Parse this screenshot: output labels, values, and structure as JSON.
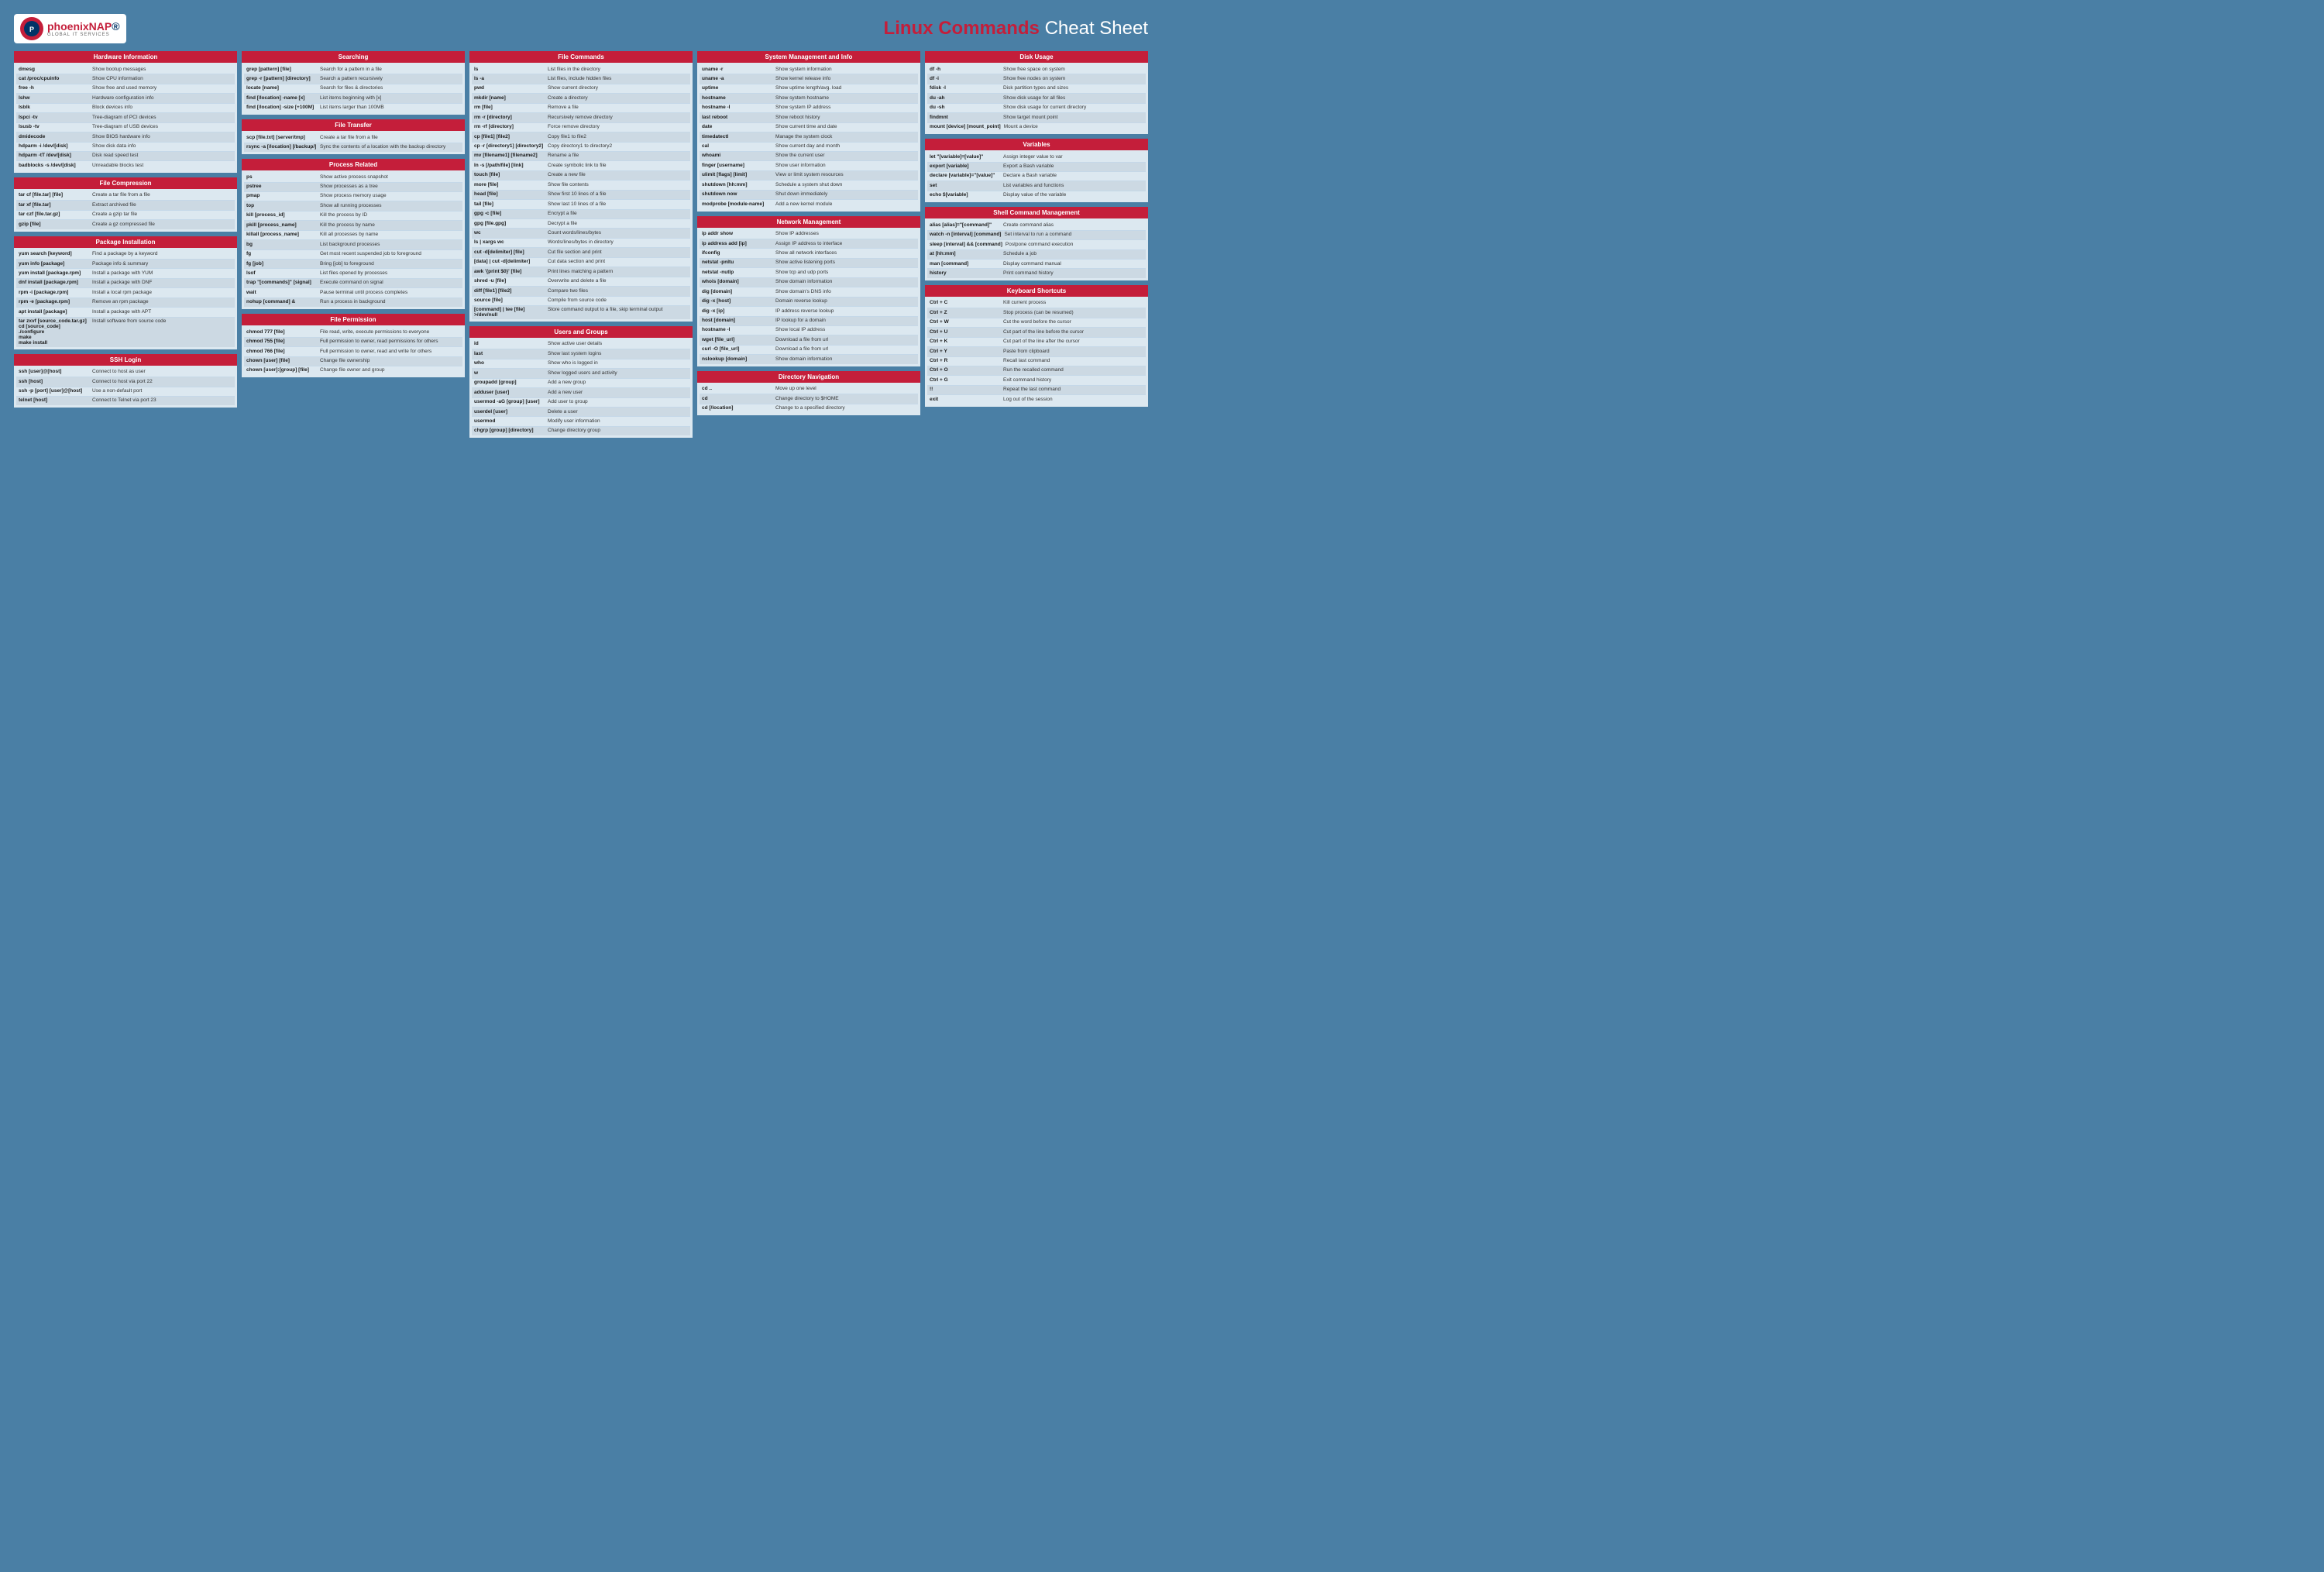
{
  "header": {
    "title_bold": "Linux Commands",
    "title_light": "Cheat Sheet",
    "logo_main_1": "phoenix",
    "logo_main_2": "NAP",
    "logo_sub": "GLOBAL IT SERVICES"
  },
  "sections": {
    "hardware_information": {
      "title": "Hardware Information",
      "commands": [
        [
          "dmesg",
          "Show bootup messages"
        ],
        [
          "cat /proc/cpuinfo",
          "Show CPU information"
        ],
        [
          "free -h",
          "Show free and used memory"
        ],
        [
          "lshw",
          "Hardware configuration info"
        ],
        [
          "lsblk",
          "Block devices info"
        ],
        [
          "lspci -tv",
          "Tree-diagram of PCI devices"
        ],
        [
          "lsusb -tv",
          "Tree-diagram of USB devices"
        ],
        [
          "dmidecode",
          "Show BIOS hardware info"
        ],
        [
          "hdparm -i /dev/[disk]",
          "Show disk data info"
        ],
        [
          "hdparm -tT /dev/[disk]",
          "Disk read speed test"
        ],
        [
          "badblocks -s /dev/[disk]",
          "Unreadable blocks test"
        ]
      ]
    },
    "file_compression": {
      "title": "File Compression",
      "commands": [
        [
          "tar cf [file.tar] [file]",
          "Create a tar file from a file"
        ],
        [
          "tar xf [file.tar]",
          "Extract archived file"
        ],
        [
          "tar czf [file.tar.gz]",
          "Create a gzip tar file"
        ],
        [
          "gzip [file]",
          "Create a gz compressed file"
        ]
      ]
    },
    "package_installation": {
      "title": "Package Installation",
      "commands": [
        [
          "yum search [keyword]",
          "Find a package by a keyword"
        ],
        [
          "yum info [package]",
          "Package info & summary"
        ],
        [
          "yum install [package.rpm]",
          "Install a package with YUM"
        ],
        [
          "dnf install [package.rpm]",
          "Install a package with DNF"
        ],
        [
          "rpm -i [package.rpm]",
          "Install a local rpm package"
        ],
        [
          "rpm -e [package.rpm]",
          "Remove an rpm package"
        ],
        [
          "apt install [package]",
          "Install a package with APT"
        ],
        [
          "tar zxvf [source_code.tar.gz]\ncd [source_code]\n./configure\nmake\nmake install",
          "Install software from source code"
        ]
      ]
    },
    "ssh_login": {
      "title": "SSH Login",
      "commands": [
        [
          "ssh [user]@[host]",
          "Connect to host as user"
        ],
        [
          "ssh [host]",
          "Connect to host via port 22"
        ],
        [
          "ssh -p [port] [user]@[host]",
          "Use a non-default port"
        ],
        [
          "telnet [host]",
          "Connect to Telnet via port 23"
        ]
      ]
    },
    "searching": {
      "title": "Searching",
      "commands": [
        [
          "grep [pattern] [file]",
          "Search for a pattern in a file"
        ],
        [
          "grep -r [pattern] [directory]",
          "Search a pattern recursively"
        ],
        [
          "locate [name]",
          "Search for files & directories"
        ],
        [
          "find [/location] -name [x]",
          "List items beginning with [x]"
        ],
        [
          "find [/location] -size [+100M]",
          "List items larger than 100MB"
        ]
      ]
    },
    "file_transfer": {
      "title": "File Transfer",
      "commands": [
        [
          "scp [file.txt] [server/tmp]",
          "Create a tar file from a file"
        ],
        [
          "rsync -a [/location] [/backup/]",
          "Sync the contents of a location with the backup directory"
        ]
      ]
    },
    "process_related": {
      "title": "Process Related",
      "commands": [
        [
          "ps",
          "Show active process snapshot"
        ],
        [
          "pstree",
          "Show processes as a tree"
        ],
        [
          "pmap",
          "Show process memory usage"
        ],
        [
          "top",
          "Show all running processes"
        ],
        [
          "kill [process_id]",
          "Kill the process by ID"
        ],
        [
          "pkill [process_name]",
          "Kill the process by name"
        ],
        [
          "killall [process_name]",
          "Kill all processes by name"
        ],
        [
          "bg",
          "List background processes"
        ],
        [
          "fg",
          "Get most recent suspended job to foreground"
        ],
        [
          "fg [job]",
          "Bring [job] to foreground"
        ],
        [
          "lsof",
          "List files opened by processes"
        ],
        [
          "trap \"[commands]\" [signal]",
          "Execute command on signal"
        ],
        [
          "wait",
          "Pause terminal until process completes"
        ],
        [
          "nohup [command] &",
          "Run a process in background"
        ]
      ]
    },
    "file_permission": {
      "title": "File Permission",
      "commands": [
        [
          "chmod 777 [file]",
          "File read, write, execute permissions to everyone"
        ],
        [
          "chmod 755 [file]",
          "Full permission to owner, read permissions for others"
        ],
        [
          "chmod 766 [file]",
          "Full permission to owner, read and write for others"
        ],
        [
          "chown [user] [file]",
          "Change file ownership"
        ],
        [
          "chown [user]:[group] [file]",
          "Change file owner and group"
        ]
      ]
    },
    "file_commands": {
      "title": "File Commands",
      "commands": [
        [
          "ls",
          "List files in the directory"
        ],
        [
          "ls -a",
          "List files, include hidden files"
        ],
        [
          "pwd",
          "Show current directory"
        ],
        [
          "mkdir [name]",
          "Create a directory"
        ],
        [
          "rm [file]",
          "Remove a file"
        ],
        [
          "rm -r [directory]",
          "Recursively remove directory"
        ],
        [
          "rm -rf [directory]",
          "Force remove directory"
        ],
        [
          "cp [file1] [file2]",
          "Copy file1 to file2"
        ],
        [
          "cp -r [directory1] [directory2]",
          "Copy directory1 to directory2"
        ],
        [
          "mv [filename1] [filename2]",
          "Rename a file"
        ],
        [
          "ln -s [/path/file] [link]",
          "Create symbolic link to file"
        ],
        [
          "touch [file]",
          "Create a new file"
        ],
        [
          "more [file]",
          "Show file contents"
        ],
        [
          "head [file]",
          "Show first 10 lines of a file"
        ],
        [
          "tail [file]",
          "Show last 10 lines of a file"
        ],
        [
          "gpg -c [file]",
          "Encrypt a file"
        ],
        [
          "gpg [file.gpg]",
          "Decrypt a file"
        ],
        [
          "wc",
          "Count words/lines/bytes"
        ],
        [
          "ls | xargs wc",
          "Words/lines/bytes in directory"
        ],
        [
          "cut -d[delimiter] [file]",
          "Cut file section and print"
        ],
        [
          "[data] | cut -d[delimiter]",
          "Cut data section and print"
        ],
        [
          "awk '{print $0}' [file]",
          "Print lines matching a pattern"
        ],
        [
          "shred -u [file]",
          "Overwrite and delete a file"
        ],
        [
          "diff [file1] [file2]",
          "Compare two files"
        ],
        [
          "source [file]",
          "Compile from source code"
        ],
        [
          "[command] | tee [file] >/dev/null",
          "Store command output to a file, skip terminal output"
        ]
      ]
    },
    "users_and_groups": {
      "title": "Users and Groups",
      "commands": [
        [
          "id",
          "Show active user details"
        ],
        [
          "last",
          "Show last system logins"
        ],
        [
          "who",
          "Show who is logged in"
        ],
        [
          "w",
          "Show logged users and activity"
        ],
        [
          "groupadd [group]",
          "Add a new group"
        ],
        [
          "adduser [user]",
          "Add a new user"
        ],
        [
          "usermod -aG [group] [user]",
          "Add user to group"
        ],
        [
          "userdel [user]",
          "Delete a user"
        ],
        [
          "usermod",
          "Modify user information"
        ],
        [
          "chgrp [group] [directory]",
          "Change directory group"
        ]
      ]
    },
    "system_management": {
      "title": "System Management and Info",
      "commands": [
        [
          "uname -r",
          "Show system information"
        ],
        [
          "uname -a",
          "Show kernel release info"
        ],
        [
          "uptime",
          "Show uptime length/avg. load"
        ],
        [
          "hostname",
          "Show system hostname"
        ],
        [
          "hostname -I",
          "Show system IP address"
        ],
        [
          "last reboot",
          "Show reboot history"
        ],
        [
          "date",
          "Show current time and date"
        ],
        [
          "timedatectl",
          "Manage the system clock"
        ],
        [
          "cal",
          "Show current day and month"
        ],
        [
          "whoami",
          "Show the current user"
        ],
        [
          "finger [username]",
          "Show user information"
        ],
        [
          "ulimit [flags] [limit]",
          "View or limit system resources"
        ],
        [
          "shutdown [hh:mm]",
          "Schedule a system shut down"
        ],
        [
          "shutdown now",
          "Shut down immediately"
        ],
        [
          "modprobe [module-name]",
          "Add a new kernel module"
        ]
      ]
    },
    "network_management": {
      "title": "Network Management",
      "commands": [
        [
          "ip addr show",
          "Show IP addresses"
        ],
        [
          "ip address add [ip]",
          "Assign IP address to interface"
        ],
        [
          "ifconfig",
          "Show all network interfaces"
        ],
        [
          "netstat -pnltu",
          "Show active listening ports"
        ],
        [
          "netstat -nutlp",
          "Show tcp and udp ports"
        ],
        [
          "whois [domain]",
          "Show domain information"
        ],
        [
          "dig [domain]",
          "Show domain's DNS info"
        ],
        [
          "dig -x [host]",
          "Domain reverse lookup"
        ],
        [
          "dig -x [ip]",
          "IP address reverse lookup"
        ],
        [
          "host [domain]",
          "IP lookup for a domain"
        ],
        [
          "hostname -I",
          "Show local IP address"
        ],
        [
          "wget [file_url]",
          "Download a file from url"
        ],
        [
          "curl -O [file_url]",
          "Download a file from url"
        ],
        [
          "nslookup [domain]",
          "Show domain information"
        ]
      ]
    },
    "directory_navigation": {
      "title": "Directory Navigation",
      "commands": [
        [
          "cd ..",
          "Move up one level"
        ],
        [
          "cd",
          "Change directory to $HOME"
        ],
        [
          "cd [/location]",
          "Change to a specified directory"
        ]
      ]
    },
    "disk_usage": {
      "title": "Disk Usage",
      "commands": [
        [
          "df -h",
          "Show free space on system"
        ],
        [
          "df -i",
          "Show free nodes on system"
        ],
        [
          "fdisk -l",
          "Disk partition types and sizes"
        ],
        [
          "du -ah",
          "Show disk usage for all files"
        ],
        [
          "du -sh",
          "Show disk usage for current directory"
        ],
        [
          "findmnt",
          "Show target mount point"
        ],
        [
          "mount [device] [mount_point]",
          "Mount a device"
        ]
      ]
    },
    "variables": {
      "title": "Variables",
      "commands": [
        [
          "let \"[variable]=[value]\"",
          "Assign integer value to var"
        ],
        [
          "export [variable]",
          "Export a Bash variable"
        ],
        [
          "declare [variable]=\"[value]\"",
          "Declare a Bash variable"
        ],
        [
          "set",
          "List variables and functions"
        ],
        [
          "echo $[variable]",
          "Display value of the variable"
        ]
      ]
    },
    "shell_command_management": {
      "title": "Shell Command Management",
      "commands": [
        [
          "alias [alias]=\"[command]\"",
          "Create command alias"
        ],
        [
          "watch -n [interval] [command]",
          "Set interval to run a command"
        ],
        [
          "sleep [interval] && [command]",
          "Postpone command execution"
        ],
        [
          "at [hh:mm]",
          "Schedule a job"
        ],
        [
          "man [command]",
          "Display command manual"
        ],
        [
          "history",
          "Print command history"
        ]
      ]
    },
    "keyboard_shortcuts": {
      "title": "Keyboard Shortcuts",
      "commands": [
        [
          "Ctrl + C",
          "Kill current process"
        ],
        [
          "Ctrl + Z",
          "Stop process (can be resumed)"
        ],
        [
          "Ctrl + W",
          "Cut the word before the cursor"
        ],
        [
          "Ctrl + U",
          "Cut part of the line before the cursor"
        ],
        [
          "Ctrl + K",
          "Cut part of the line after the cursor"
        ],
        [
          "Ctrl + Y",
          "Paste from clipboard"
        ],
        [
          "Ctrl + R",
          "Recall last command"
        ],
        [
          "Ctrl + O",
          "Run the recalled command"
        ],
        [
          "Ctrl + G",
          "Exit command history"
        ],
        [
          "!!",
          "Repeat the last command"
        ],
        [
          "exit",
          "Log out of the session"
        ]
      ]
    }
  }
}
